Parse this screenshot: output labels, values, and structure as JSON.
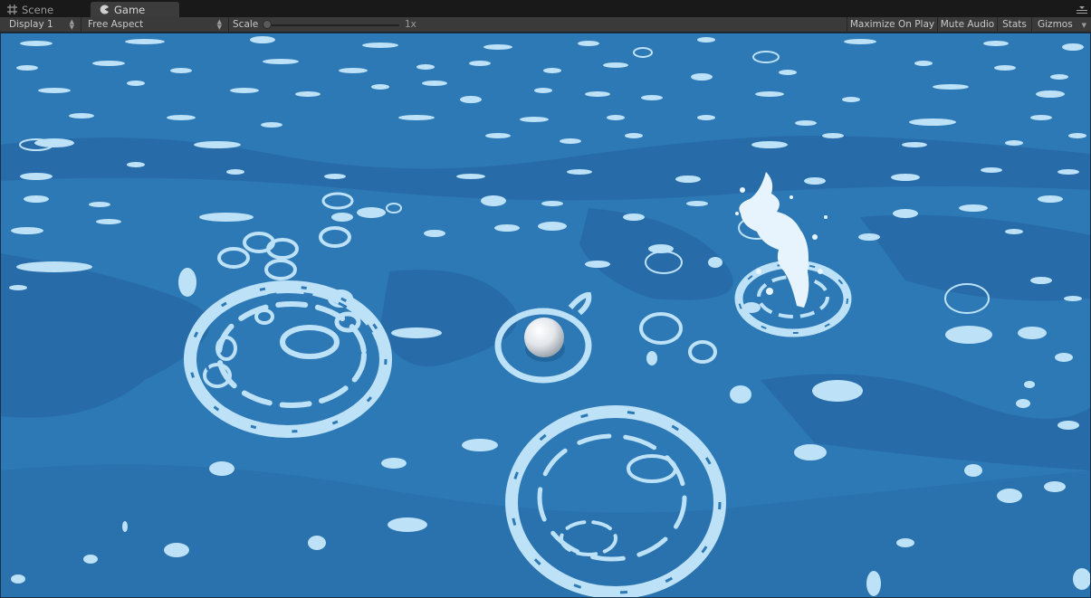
{
  "tabs": [
    {
      "label": "Scene",
      "icon": "grid-icon"
    },
    {
      "label": "Game",
      "icon": "pacman-icon"
    }
  ],
  "toolbar": {
    "display": "Display 1",
    "aspect": "Free Aspect",
    "scale_label": "Scale",
    "scale_value": "1x",
    "scale": 0.0,
    "maximize_on_play": "Maximize On Play",
    "mute_audio": "Mute Audio",
    "stats": "Stats",
    "gizmos": "Gizmos"
  },
  "colors": {
    "water": "#2d79b6",
    "water_dark": "#2569a3",
    "foam": "#bde1f7",
    "panel": "#3a3a3a"
  }
}
